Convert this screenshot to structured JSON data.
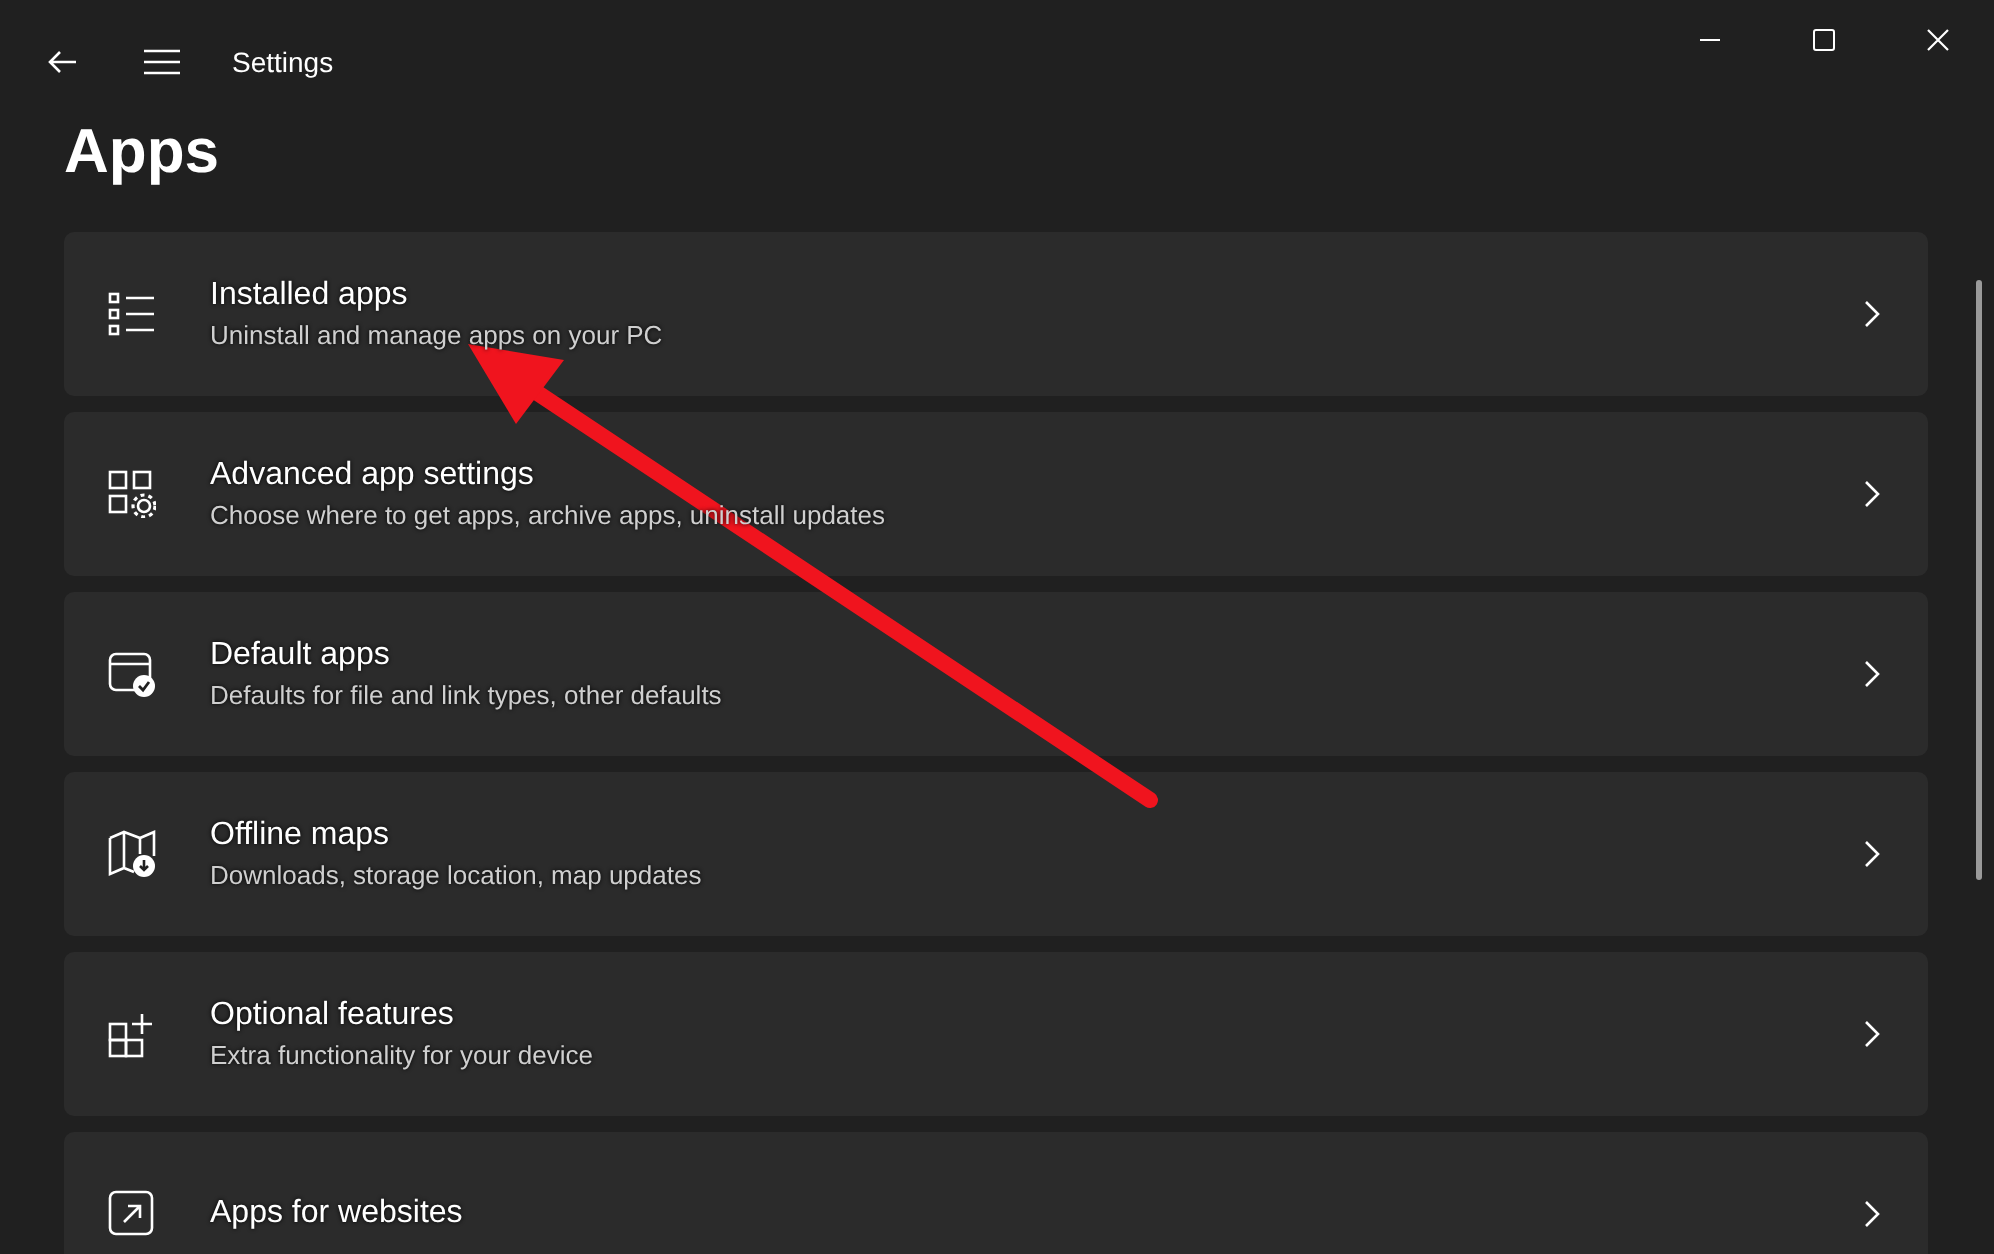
{
  "window": {
    "title": "Settings"
  },
  "page": {
    "title": "Apps"
  },
  "items": [
    {
      "kind": "list",
      "title": "Installed apps",
      "subtitle": "Uninstall and manage apps on your PC"
    },
    {
      "kind": "gear",
      "title": "Advanced app settings",
      "subtitle": "Choose where to get apps, archive apps, uninstall updates"
    },
    {
      "kind": "check",
      "title": "Default apps",
      "subtitle": "Defaults for file and link types, other defaults"
    },
    {
      "kind": "map",
      "title": "Offline maps",
      "subtitle": "Downloads, storage location, map updates"
    },
    {
      "kind": "grid",
      "title": "Optional features",
      "subtitle": "Extra functionality for your device"
    },
    {
      "kind": "web",
      "title": "Apps for websites"
    }
  ]
}
